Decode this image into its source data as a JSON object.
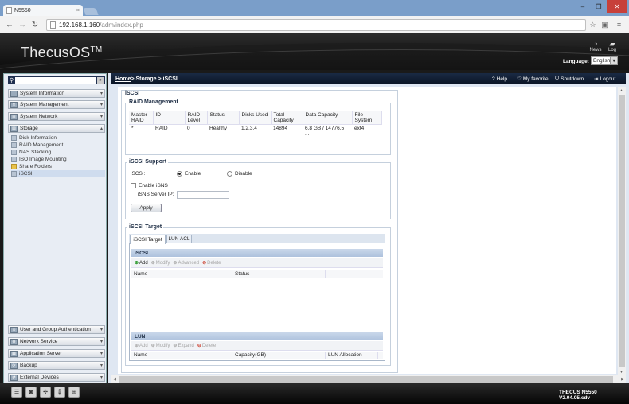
{
  "browser": {
    "tab_title": "N5550",
    "tab_close": "×",
    "url_host": "192.168.1.160",
    "url_path": "/adm/index.php",
    "win_min": "–",
    "win_max": "❐",
    "win_close": "✕"
  },
  "header": {
    "logo": "ThecusOS",
    "logo_tm": "TM",
    "news_label": "News",
    "log_label": "Log",
    "language_label": "Language:",
    "language_value": "English"
  },
  "sidebar": {
    "categories_top": [
      {
        "label": "System Information"
      },
      {
        "label": "System Management"
      },
      {
        "label": "System Network"
      },
      {
        "label": "Storage"
      }
    ],
    "storage_items": [
      {
        "label": "Disk Information"
      },
      {
        "label": "RAID Management"
      },
      {
        "label": "NAS Stacking"
      },
      {
        "label": "ISO Image Mounting"
      },
      {
        "label": "Share Folders"
      },
      {
        "label": "iSCSI"
      }
    ],
    "categories_bottom": [
      {
        "label": "User and Group Authentication"
      },
      {
        "label": "Network Service"
      },
      {
        "label": "Application Server"
      },
      {
        "label": "Backup"
      },
      {
        "label": "External Devices"
      }
    ]
  },
  "topbar": {
    "breadcrumb_home": "Home",
    "breadcrumb_rest": " > Storage > iSCSI",
    "help": "Help",
    "my_favorite": "My favorite",
    "shutdown": "Shutdown",
    "logout": "Logout"
  },
  "page": {
    "title": "iSCSI",
    "raid": {
      "legend": "RAID Management",
      "columns": [
        "Master RAID",
        "ID",
        "RAID Level",
        "Status",
        "Disks Used",
        "Total Capacity",
        "Data Capacity",
        "File System"
      ],
      "rows": [
        [
          "*",
          "RAID",
          "0",
          "Healthy",
          "1,2,3,4",
          "14894",
          "6.8 GB / 14776.5 ...",
          "ext4"
        ]
      ]
    },
    "support": {
      "legend": "iSCSI Support",
      "iscsi_label": "iSCSI:",
      "enable": "Enable",
      "disable": "Disable",
      "enable_isns": "Enable iSNS",
      "isns_ip_label": "iSNS Server IP:",
      "isns_ip_value": "",
      "apply": "Apply"
    },
    "target": {
      "legend": "iSCSI Target",
      "tabs": [
        {
          "label": "iSCSI Target"
        },
        {
          "label": "LUN ACL"
        }
      ],
      "iscsi_band": "iSCSI",
      "iscsi_toolbar": {
        "add": "Add",
        "modify": "Modify",
        "advanced": "Advanced",
        "delete": "Delete"
      },
      "iscsi_columns": [
        "Name",
        "Status"
      ],
      "lun_band": "LUN",
      "lun_toolbar": {
        "add": "Add",
        "modify": "Modify",
        "expand": "Expand",
        "delete": "Delete"
      },
      "lun_columns": [
        "Name",
        "Capacity(GB)",
        "LUN Allocation"
      ]
    }
  },
  "footer": {
    "version": "THECUS N5550 V2.04.05.cdv"
  }
}
